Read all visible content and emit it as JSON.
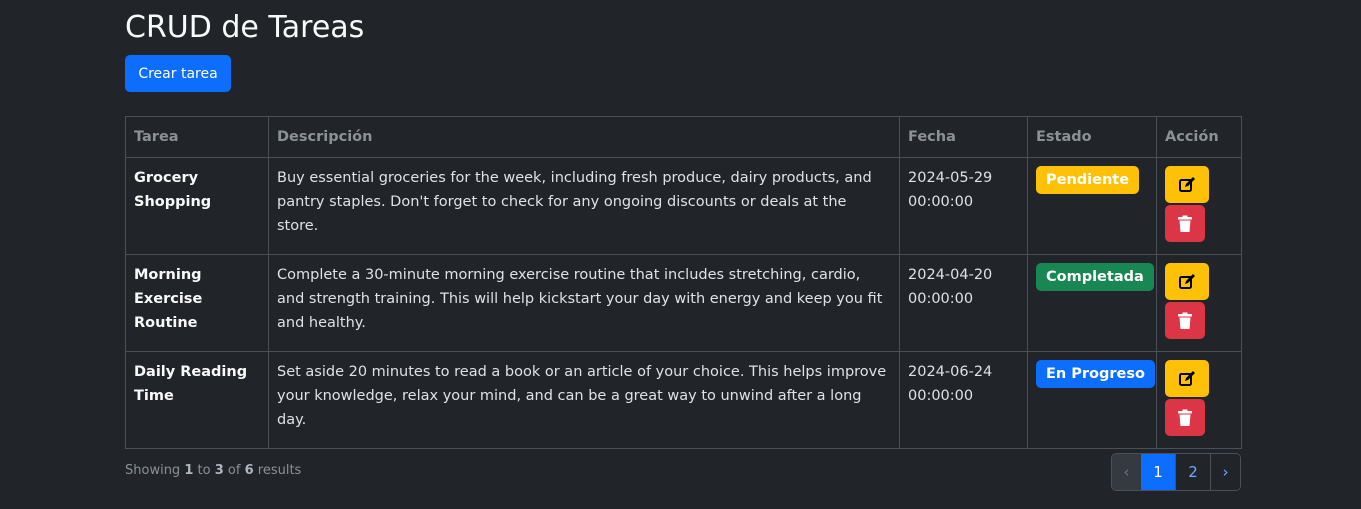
{
  "header": {
    "title": "CRUD de Tareas",
    "create_label": "Crear tarea"
  },
  "table": {
    "columns": [
      "Tarea",
      "Descripción",
      "Fecha",
      "Estado",
      "Acción"
    ],
    "rows": [
      {
        "task": "Grocery Shopping",
        "description": "Buy essential groceries for the week, including fresh produce, dairy products, and pantry staples. Don't forget to check for any ongoing discounts or deals at the store.",
        "date": "2024-05-29 00:00:00",
        "status": "Pendiente",
        "status_color": "#ffc107"
      },
      {
        "task": "Morning Exercise Routine",
        "description": "Complete a 30-minute morning exercise routine that includes stretching, cardio, and strength training. This will help kickstart your day with energy and keep you fit and healthy.",
        "date": "2024-04-20 00:00:00",
        "status": "Completada",
        "status_color": "#198754"
      },
      {
        "task": "Daily Reading Time",
        "description": "Set aside 20 minutes to read a book or an article of your choice. This helps improve your knowledge, relax your mind, and can be a great way to unwind after a long day.",
        "date": "2024-06-24 00:00:00",
        "status": "En Progreso",
        "status_color": "#0d6efd"
      }
    ],
    "action_icons": [
      "edit-icon",
      "trash-icon"
    ]
  },
  "footer": {
    "showing_prefix": "Showing",
    "from": "1",
    "to_word": "to",
    "to": "3",
    "of_word": "of",
    "total": "6",
    "suffix": "results"
  },
  "pagination": {
    "prev": "‹",
    "pages": [
      "1",
      "2"
    ],
    "current": "1",
    "next": "›"
  },
  "colors": {
    "background": "#212529",
    "primary": "#0d6efd",
    "warning": "#ffc107",
    "success": "#198754",
    "danger": "#dc3545"
  }
}
